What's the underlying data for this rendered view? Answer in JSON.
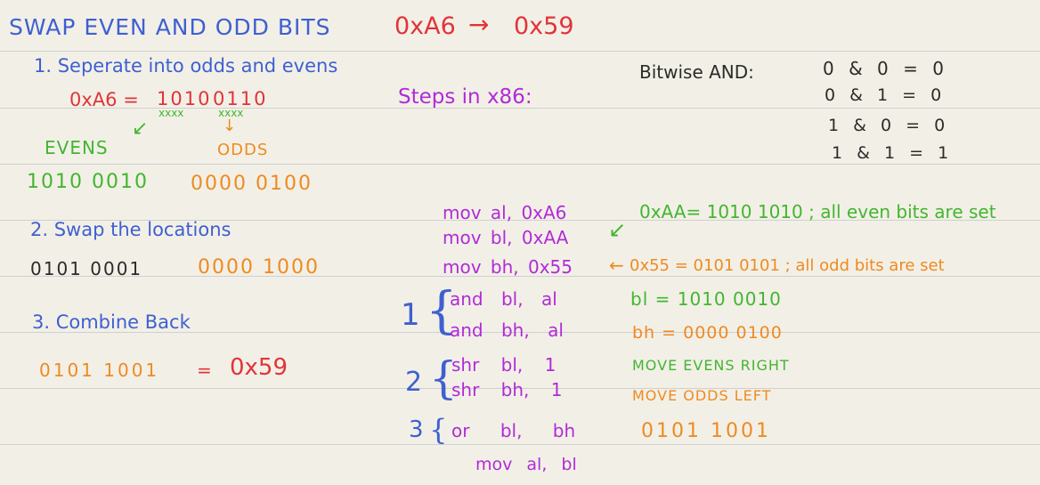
{
  "title": {
    "text": "SWAP EVEN AND ODD BITS",
    "conversion": "0xA6",
    "result": "0x59"
  },
  "step1": {
    "heading": "1. Seperate into odds and evens",
    "hex_eq": "0xA6 =",
    "binary_high": "1010",
    "binary_low": "0110",
    "even_marks": "xxxx",
    "odd_marks": "xxxx",
    "evens_label": "EVENS",
    "odds_label": "ODDS",
    "evens_value": "1010 0010",
    "odds_value": "0000 0100"
  },
  "step2": {
    "heading": "2. Swap the locations",
    "evens_value": "0101 0001",
    "odds_value": "0000 1000"
  },
  "step3": {
    "heading": "3. Combine Back",
    "combined": "0101 1001",
    "equals": "=",
    "result": "0x59"
  },
  "x86": {
    "heading": "Steps in x86:",
    "mov1": "mov al, 0xA6",
    "mov2": "mov bl, 0xAA",
    "mov3": "mov bh, 0x55",
    "note_aa": "0xAA= 1010 1010 ; all even bits are set",
    "note_55": "0x55 = 0101 0101 ; all odd bits are set",
    "group1_num": "1",
    "and1": "and bl, al",
    "and2": "and bh, al",
    "and1_result": "bl = 1010 0010",
    "and2_result": "bh = 0000 0100",
    "group2_num": "2",
    "shr1": "shr bl, 1",
    "shr2": "shr bh, 1",
    "shr1_note": "MOVE EVENS RIGHT",
    "shr2_note": "MOVE ODDS LEFT",
    "group3_num": "3",
    "or1": "or bl, bh",
    "or_result": "0101 1001",
    "mov_final": "mov al, bl"
  },
  "truth_table": {
    "label": "Bitwise AND:",
    "rows": [
      "0 & 0 = 0",
      "0 & 1 = 0",
      "1 & 0 = 0",
      "1 & 1 = 1"
    ]
  }
}
